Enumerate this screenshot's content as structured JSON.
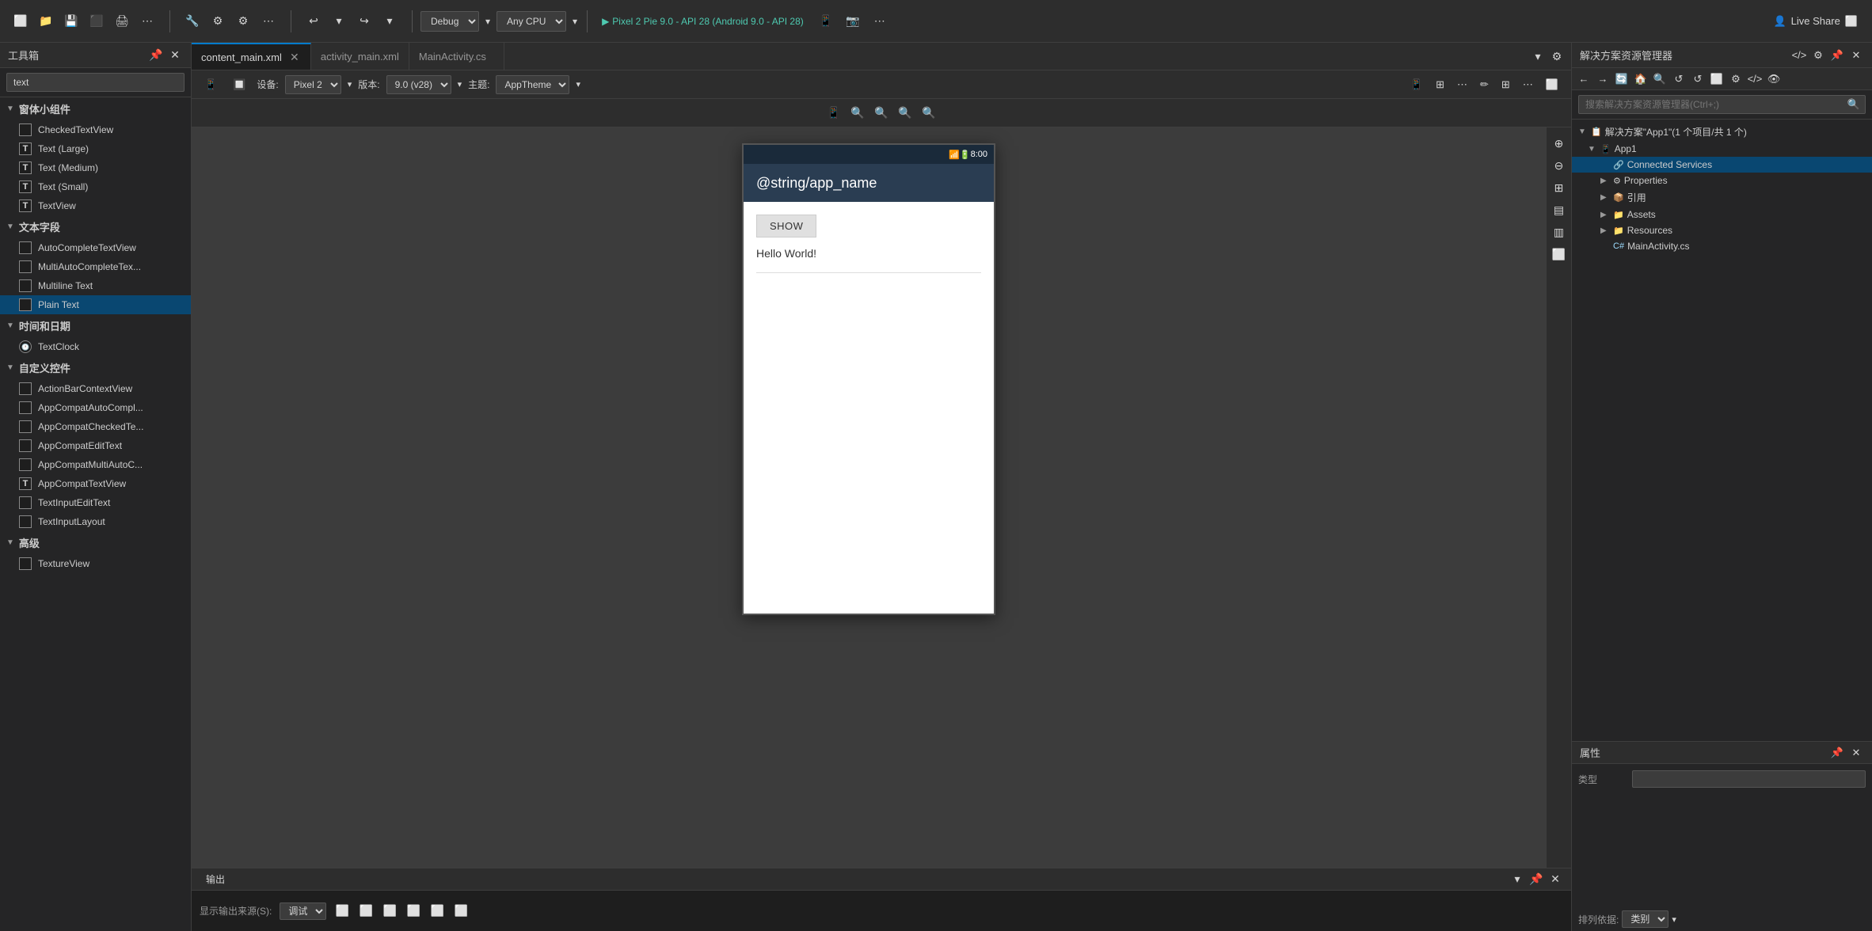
{
  "toolbar": {
    "debug_label": "Debug",
    "cpu_label": "Any CPU",
    "device_label": "Pixel 2 Pie 9.0 - API 28 (Android 9.0 - API 28)",
    "liveshare_label": "Live Share",
    "undo_label": "↩",
    "redo_label": "↪"
  },
  "left_panel": {
    "title": "工具箱",
    "search_placeholder": "text",
    "sections": [
      {
        "name": "窗体小组件",
        "expanded": true,
        "items": [
          {
            "label": "CheckedTextView",
            "icon_type": "lines"
          },
          {
            "label": "Text (Large)",
            "icon_type": "T"
          },
          {
            "label": "Text (Medium)",
            "icon_type": "T"
          },
          {
            "label": "Text (Small)",
            "icon_type": "T"
          },
          {
            "label": "TextView",
            "icon_type": "T"
          }
        ]
      },
      {
        "name": "文本字段",
        "expanded": true,
        "items": [
          {
            "label": "AutoCompleteTextView",
            "icon_type": "lines"
          },
          {
            "label": "MultiAutoCompleteTex...",
            "icon_type": "lines"
          },
          {
            "label": "Multiline Text",
            "icon_type": "lines"
          },
          {
            "label": "Plain Text",
            "icon_type": "lines",
            "highlighted": true
          }
        ]
      },
      {
        "name": "时间和日期",
        "expanded": true,
        "items": [
          {
            "label": "TextClock",
            "icon_type": "clock"
          }
        ]
      },
      {
        "name": "自定义控件",
        "expanded": true,
        "items": [
          {
            "label": "ActionBarContextView",
            "icon_type": "rect"
          },
          {
            "label": "AppCompatAutoCompl...",
            "icon_type": "lines"
          },
          {
            "label": "AppCompatCheckedTe...",
            "icon_type": "lines"
          },
          {
            "label": "AppCompatEditText",
            "icon_type": "lines"
          },
          {
            "label": "AppCompatMultiAutoC...",
            "icon_type": "lines"
          },
          {
            "label": "AppCompatTextView",
            "icon_type": "T"
          },
          {
            "label": "TextInputEditText",
            "icon_type": "lines"
          },
          {
            "label": "TextInputLayout",
            "icon_type": "rect"
          }
        ]
      },
      {
        "name": "高级",
        "expanded": true,
        "items": [
          {
            "label": "TextureView",
            "icon_type": "rect"
          }
        ]
      }
    ]
  },
  "tabs": [
    {
      "label": "content_main.xml",
      "active": true
    },
    {
      "label": "activity_main.xml",
      "active": false
    },
    {
      "label": "MainActivity.cs",
      "active": false
    }
  ],
  "designer": {
    "device_label": "设备:",
    "device_value": "Pixel 2",
    "version_label": "版本:",
    "version_value": "9.0 (v28)",
    "theme_label": "主题:",
    "theme_value": "AppTheme"
  },
  "phone": {
    "status_time": "8:00",
    "app_title": "@string/app_name",
    "show_button": "SHOW",
    "hello_text": "Hello World!"
  },
  "right_panel": {
    "title": "解决方案资源管理器",
    "search_placeholder": "搜索解决方案资源管理器(Ctrl+;)",
    "solution_label": "解决方案\"App1\"(1 个项目/共 1 个)",
    "app_name": "App1",
    "connected_services": "Connected Services",
    "properties": "Properties",
    "references": "引用",
    "assets": "Assets",
    "resources": "Resources",
    "main_activity": "MainActivity.cs"
  },
  "properties_panel": {
    "title": "属性",
    "type_label": "类型",
    "sort_label": "排列依据:",
    "sort_value": "类别"
  },
  "output_panel": {
    "title": "输出",
    "source_label": "显示输出来源(S):",
    "source_value": "调试"
  }
}
